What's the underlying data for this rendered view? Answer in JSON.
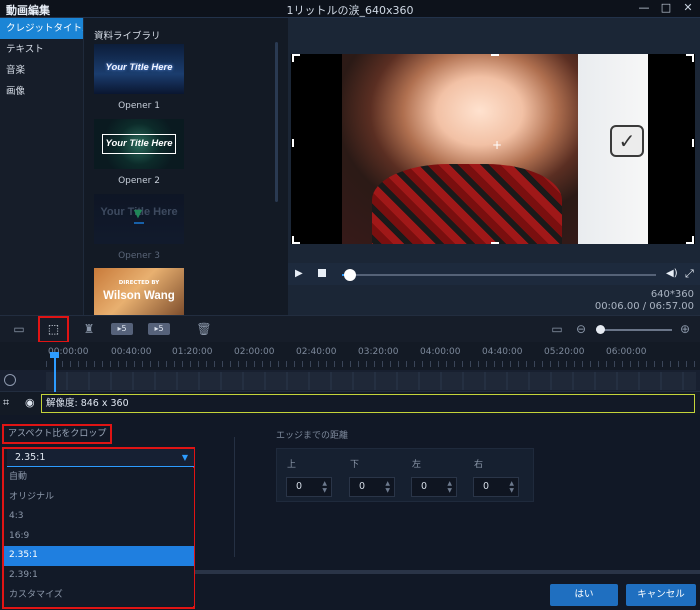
{
  "titlebar": {
    "app_title": "動画編集",
    "window_title": "1リットルの涙_640x360",
    "controls": [
      "—",
      "□",
      "✕"
    ]
  },
  "categories": [
    {
      "label": "クレジットタイトル",
      "active": true
    },
    {
      "label": "テキスト",
      "active": false
    },
    {
      "label": "音楽",
      "active": false
    },
    {
      "label": "画像",
      "active": false
    }
  ],
  "library": {
    "title": "資料ライブラリ",
    "items": [
      {
        "thumb_text": "Your Title Here",
        "caption": "Opener 1"
      },
      {
        "thumb_text": "Your Title Here",
        "caption": "Opener 2"
      },
      {
        "thumb_text": "Your Title Here",
        "caption": "Opener 3"
      },
      {
        "thumb_small": "DIRECTED BY",
        "thumb_text": "Wilson Wang"
      }
    ]
  },
  "preview": {
    "resolution": "640*360",
    "time": "00:06.00 / 06:57.00",
    "progress": 0.02
  },
  "toolbar": {
    "chip1": "▸5",
    "chip2": "▸5"
  },
  "timeline": {
    "ticks": [
      "00:00:00",
      "00:40:00",
      "01:20:00",
      "02:00:00",
      "02:40:00",
      "03:20:00",
      "04:00:00",
      "04:40:00",
      "05:20:00",
      "06:00:00"
    ],
    "resolution_clip": "解像度: 846 x 360"
  },
  "crop": {
    "aspect_label": "アスペクト比をクロップ",
    "selected": "2.35:1",
    "options": [
      {
        "label": "自動",
        "selected": false
      },
      {
        "label": "オリジナル",
        "selected": false
      },
      {
        "label": "4:3",
        "selected": false
      },
      {
        "label": "16:9",
        "selected": false
      },
      {
        "label": "2.35:1",
        "selected": true
      },
      {
        "label": "2.39:1",
        "selected": false
      },
      {
        "label": "カスタマイズ",
        "selected": false
      }
    ],
    "edge_label": "エッジまでの距離",
    "edges": [
      {
        "name": "上",
        "value": "0"
      },
      {
        "name": "下",
        "value": "0"
      },
      {
        "name": "左",
        "value": "0"
      },
      {
        "name": "右",
        "value": "0"
      }
    ]
  },
  "footer": {
    "ok_label": "はい",
    "cancel_label": "キャンセル"
  }
}
